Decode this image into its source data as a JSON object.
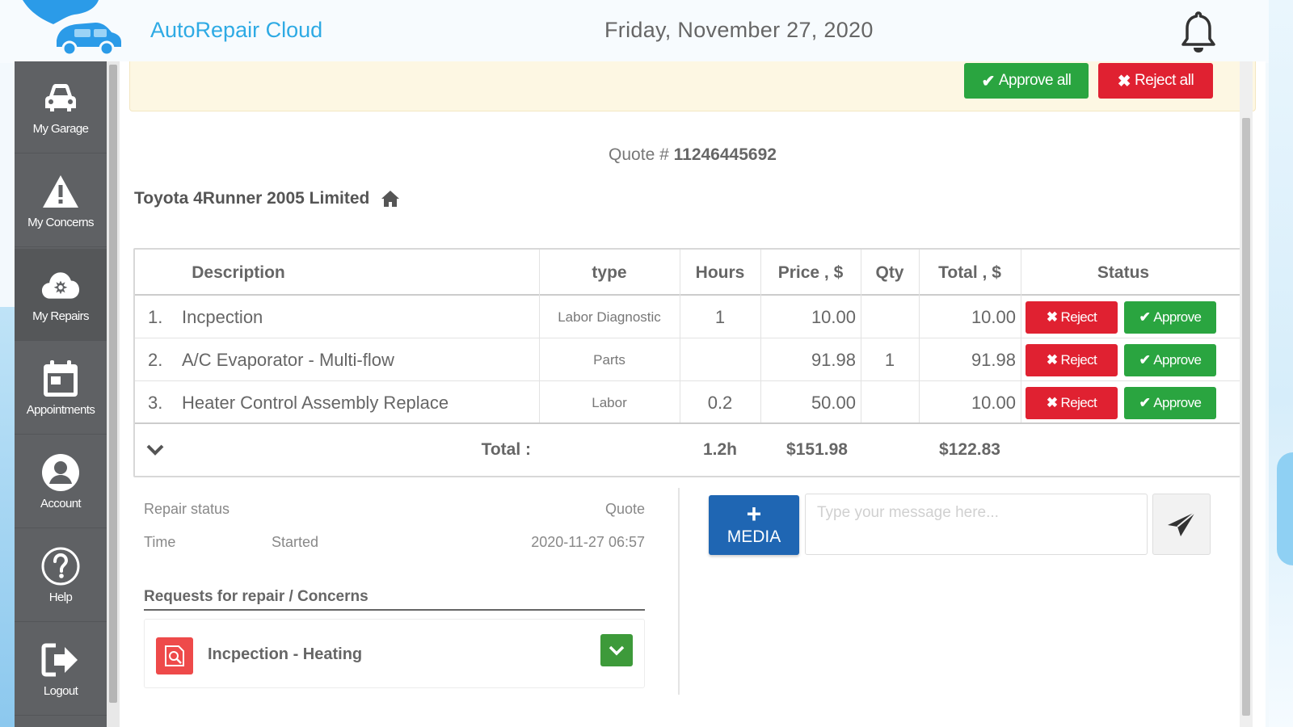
{
  "header": {
    "app_title": "AutoRepair Cloud",
    "date": "Friday, November 27, 2020"
  },
  "sidebar": {
    "items": [
      {
        "label": "My Garage",
        "icon": "car-icon"
      },
      {
        "label": "My Concerns",
        "icon": "warning-icon"
      },
      {
        "label": "My Repairs",
        "icon": "repair-cloud-icon"
      },
      {
        "label": "Appointments",
        "icon": "calendar-icon"
      },
      {
        "label": "Account",
        "icon": "user-circle-icon"
      },
      {
        "label": "Help",
        "icon": "help-icon"
      },
      {
        "label": "Logout",
        "icon": "logout-icon"
      }
    ]
  },
  "actions": {
    "approve_all": "Approve all",
    "reject_all": "Reject all"
  },
  "quote": {
    "label": "Quote #",
    "number": "11246445692"
  },
  "vehicle": "Toyota 4Runner 2005 Limited",
  "table": {
    "headers": [
      "Description",
      "type",
      "Hours",
      "Price , $",
      "Qty",
      "Total , $",
      "Status"
    ],
    "rows": [
      {
        "idx": "1.",
        "description": "Incpection",
        "type": "Labor Diagnostic",
        "hours": "1",
        "price": "10.00",
        "qty": "",
        "total": "10.00",
        "reject": "Reject",
        "approve": "Approve"
      },
      {
        "idx": "2.",
        "description": "A/C Evaporator - Multi-flow",
        "type": "Parts",
        "hours": "",
        "price": "91.98",
        "qty": "1",
        "total": "91.98",
        "reject": "Reject",
        "approve": "Approve"
      },
      {
        "idx": "3.",
        "description": "Heater Control Assembly Replace",
        "type": "Labor",
        "hours": "0.2",
        "price": "50.00",
        "qty": "",
        "total": "10.00",
        "reject": "Reject",
        "approve": "Approve"
      }
    ],
    "footer": {
      "label": "Total :",
      "hours": "1.2h",
      "price": "$151.98",
      "total": "$122.83"
    }
  },
  "repair": {
    "status_label": "Repair status",
    "status_value": "Quote",
    "time_label": "Time",
    "time_state": "Started",
    "time_value": "2020-11-27 06:57",
    "requests_title": "Requests for repair / Concerns",
    "request_item": "Incpection - Heating"
  },
  "chat": {
    "media_label": "MEDIA",
    "placeholder": "Type your message here..."
  },
  "colors": {
    "brand": "#2eaae4",
    "approve": "#2aa540",
    "reject": "#e02131",
    "media": "#1f66b3",
    "sidebar": "#5f6164"
  }
}
